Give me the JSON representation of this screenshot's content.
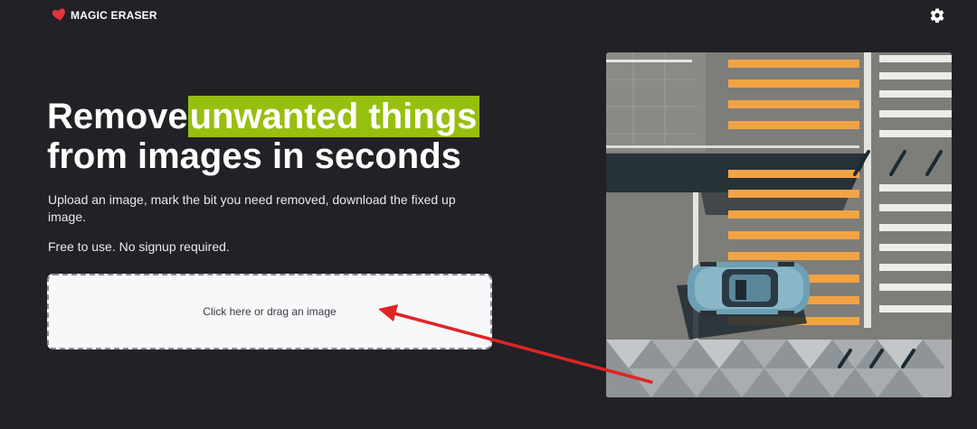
{
  "header": {
    "app_name": "MAGIC ERASER",
    "logo_icon": "heart-logo-icon",
    "settings_icon": "gear-icon"
  },
  "hero": {
    "headline_part1": "Remove",
    "headline_highlight": "unwanted things",
    "headline_line2": "from images in seconds",
    "description": "Upload an image, mark the bit you need removed, download the fixed up image.",
    "free_note": "Free to use. No signup required."
  },
  "dropzone": {
    "label": "Click here or drag an image"
  },
  "preview": {
    "description_icon": "example-image"
  },
  "colors": {
    "background": "#222126",
    "highlight": "#97bf10",
    "logo_red": "#e0353b",
    "arrow_red": "#e02424",
    "dropzone_bg": "#f7f8fa"
  }
}
